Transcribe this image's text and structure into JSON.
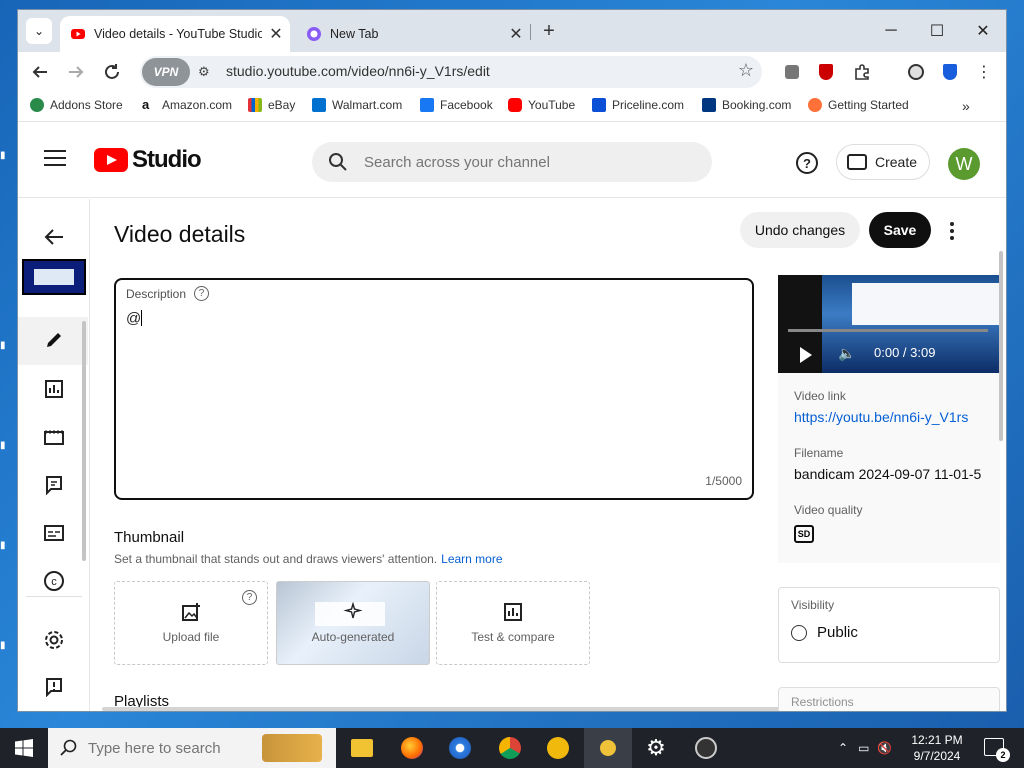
{
  "browser": {
    "tabs": [
      {
        "title": "Video details - YouTube Studio",
        "active": true
      },
      {
        "title": "New Tab",
        "active": false
      }
    ],
    "url": "studio.youtube.com/video/nn6i-y_V1rs/edit",
    "vpn_label": "VPN"
  },
  "bookmarks": [
    {
      "label": "Addons Store",
      "color": "#2a8a4a"
    },
    {
      "label": "Amazon.com",
      "color": "#111111"
    },
    {
      "label": "eBay",
      "color": "#e53238"
    },
    {
      "label": "Walmart.com",
      "color": "#0071ce"
    },
    {
      "label": "Facebook",
      "color": "#1877f2"
    },
    {
      "label": "YouTube",
      "color": "#ff0000"
    },
    {
      "label": "Priceline.com",
      "color": "#0a4fd6"
    },
    {
      "label": "Booking.com",
      "color": "#003580"
    },
    {
      "label": "Getting Started",
      "color": "#ff7139"
    }
  ],
  "studio": {
    "logo_text": "Studio",
    "search_placeholder": "Search across your channel",
    "create_label": "Create",
    "avatar_letter": "W"
  },
  "page": {
    "title": "Video details",
    "undo_label": "Undo changes",
    "save_label": "Save"
  },
  "description": {
    "label": "Description",
    "value": "@",
    "counter": "1/5000"
  },
  "thumbnail": {
    "title": "Thumbnail",
    "subtitle": "Set a thumbnail that stands out and draws viewers' attention.",
    "learn_more": "Learn more",
    "options": [
      "Upload file",
      "Auto-generated",
      "Test & compare"
    ]
  },
  "playlists": {
    "title": "Playlists"
  },
  "video_panel": {
    "time": "0:00 / 3:09",
    "link_label": "Video link",
    "link_value": "https://youtu.be/nn6i-y_V1rs",
    "filename_label": "Filename",
    "filename_value": "bandicam 2024-09-07 11-01-5",
    "quality_label": "Video quality",
    "quality_badge": "SD"
  },
  "visibility": {
    "label": "Visibility",
    "value": "Public"
  },
  "restrictions": {
    "label": "Restrictions"
  },
  "taskbar": {
    "search_placeholder": "Type here to search",
    "time": "12:21 PM",
    "date": "9/7/2024",
    "notification_count": "2"
  },
  "colors": {
    "accent": "#065fd4",
    "brand_red": "#ff0000",
    "avatar": "#5a9a2f"
  }
}
